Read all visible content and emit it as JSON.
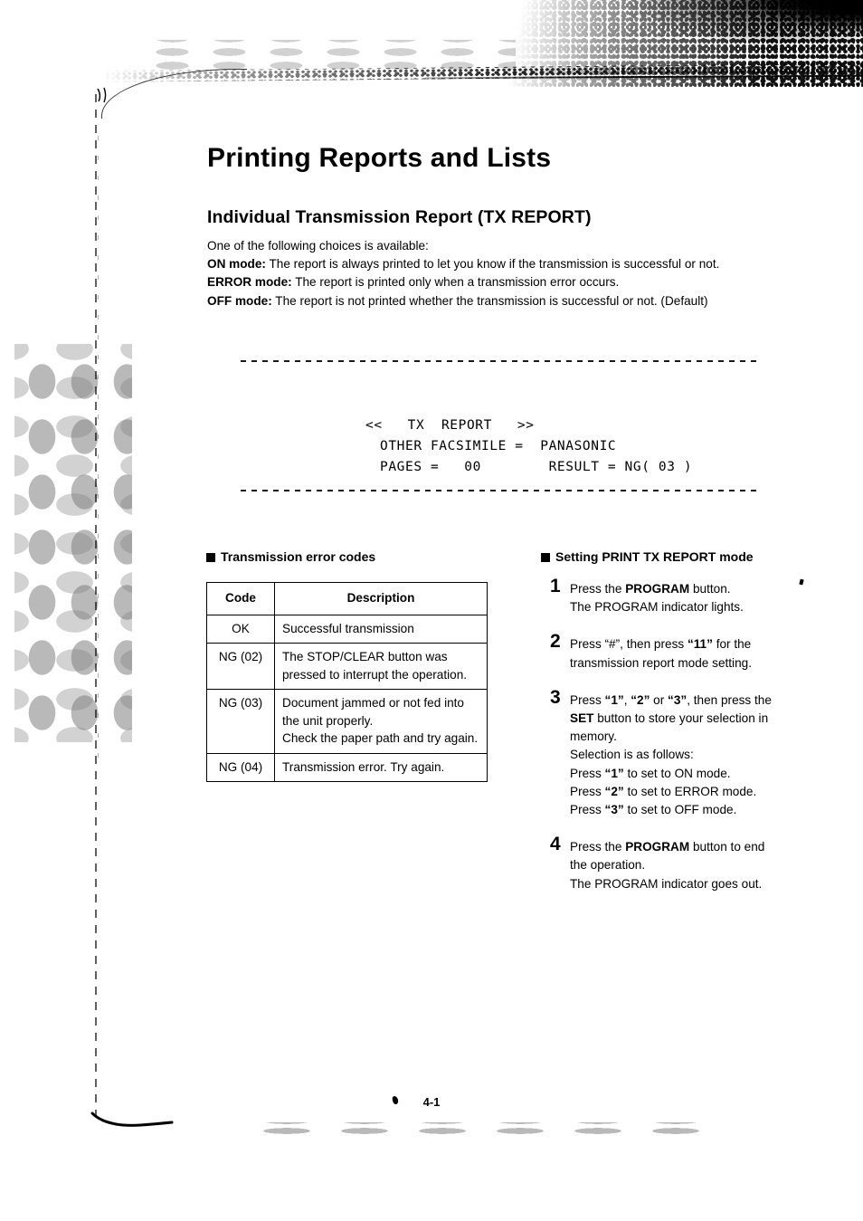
{
  "page": {
    "title": "Printing Reports and Lists",
    "section_title": "Individual Transmission Report (TX REPORT)",
    "footer_page_number": "4-1"
  },
  "intro": {
    "lead": "One of the following choices is available:",
    "modes": [
      {
        "label": "ON mode",
        "separator": ":",
        "text": "The report is always printed to let you know if the transmission is successful or not."
      },
      {
        "label": "ERROR mode",
        "separator": ":",
        "text": "The report is printed only when a transmission error occurs."
      },
      {
        "label": "OFF mode",
        "separator": ":",
        "text": "The report is not printed whether the transmission is successful or not. (Default)"
      }
    ]
  },
  "fax_sample": {
    "line1": "<<   TX  REPORT   >>",
    "line2": "OTHER FACSIMILE =  PANASONIC",
    "line3": "PAGES =   00        RESULT = NG( 03 )"
  },
  "error_codes": {
    "heading": "Transmission error codes",
    "columns": [
      "Code",
      "Description"
    ],
    "rows": [
      {
        "code": "OK",
        "description": "Successful transmission"
      },
      {
        "code": "NG (02)",
        "description": "The STOP/CLEAR button was pressed to interrupt the operation."
      },
      {
        "code": "NG (03)",
        "description": "Document jammed or not fed into the unit properly.\nCheck the paper path and try again."
      },
      {
        "code": "NG (04)",
        "description": "Transmission error. Try again."
      }
    ]
  },
  "setting_mode": {
    "heading": "Setting PRINT TX REPORT mode",
    "steps": [
      {
        "number": "1",
        "lines": [
          [
            {
              "t": "Press the "
            },
            {
              "t": "PROGRAM",
              "b": true
            },
            {
              "t": " button."
            }
          ],
          [
            {
              "t": "The PROGRAM indicator lights."
            }
          ]
        ]
      },
      {
        "number": "2",
        "lines": [
          [
            {
              "t": "Press “#”, then press "
            },
            {
              "t": "“11”",
              "b": true
            },
            {
              "t": " for the"
            }
          ],
          [
            {
              "t": "transmission report mode setting."
            }
          ]
        ]
      },
      {
        "number": "3",
        "lines": [
          [
            {
              "t": "Press "
            },
            {
              "t": "“1”",
              "b": true
            },
            {
              "t": ", "
            },
            {
              "t": "“2”",
              "b": true
            },
            {
              "t": " or "
            },
            {
              "t": "“3”",
              "b": true
            },
            {
              "t": ", then press the"
            }
          ],
          [
            {
              "t": "SET",
              "b": true
            },
            {
              "t": " button to store your selection in"
            }
          ],
          [
            {
              "t": "memory."
            }
          ],
          [
            {
              "t": "Selection is as follows:"
            }
          ],
          [
            {
              "t": "Press "
            },
            {
              "t": "“1”",
              "b": true
            },
            {
              "t": " to set to ON mode."
            }
          ],
          [
            {
              "t": "Press "
            },
            {
              "t": "“2”",
              "b": true
            },
            {
              "t": " to set to ERROR mode."
            }
          ],
          [
            {
              "t": "Press "
            },
            {
              "t": "“3”",
              "b": true
            },
            {
              "t": " to set to OFF mode."
            }
          ]
        ]
      },
      {
        "number": "4",
        "lines": [
          [
            {
              "t": "Press the "
            },
            {
              "t": "PROGRAM",
              "b": true
            },
            {
              "t": " button to end"
            }
          ],
          [
            {
              "t": "the operation."
            }
          ],
          [
            {
              "t": "The PROGRAM indicator goes out."
            }
          ]
        ]
      }
    ]
  }
}
